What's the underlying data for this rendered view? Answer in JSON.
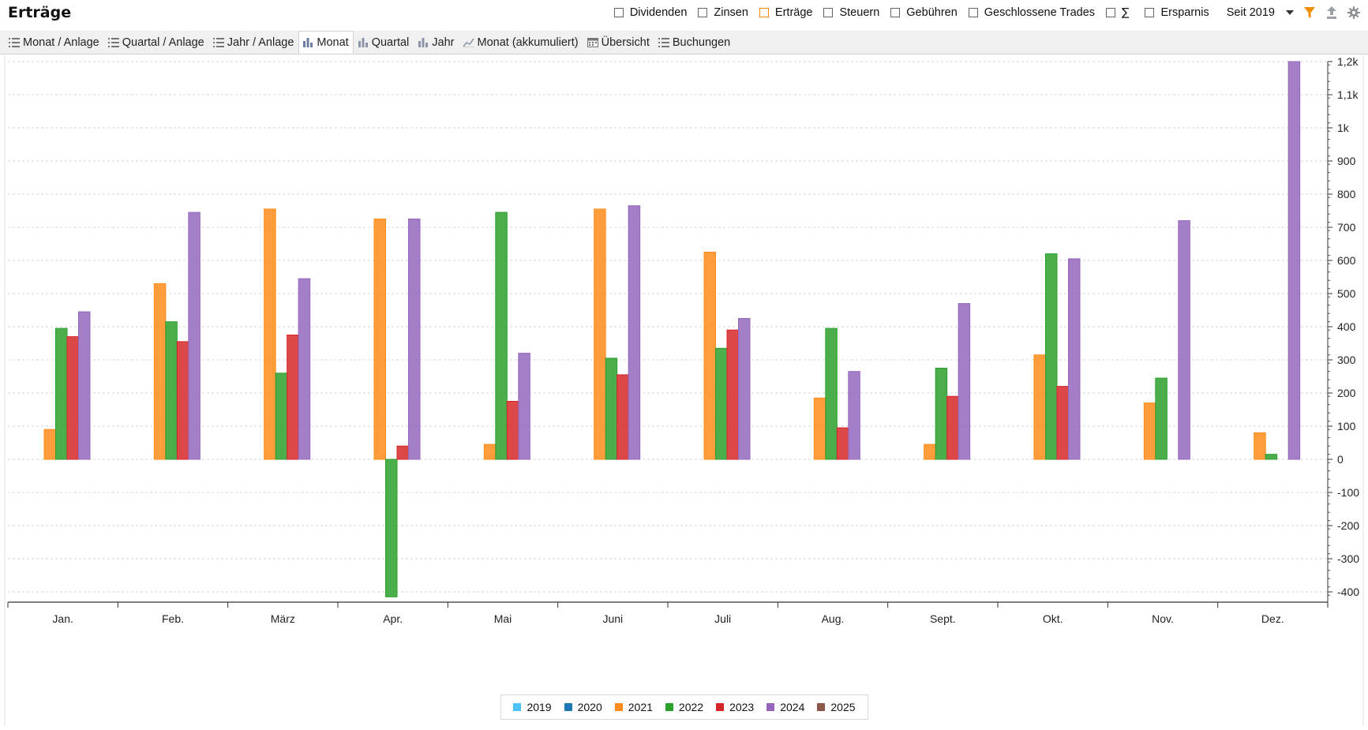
{
  "header": {
    "title": "Erträge",
    "filters": [
      {
        "label": "Dividenden",
        "active": false
      },
      {
        "label": "Zinsen",
        "active": false
      },
      {
        "label": "Erträge",
        "active": true
      },
      {
        "label": "Steuern",
        "active": false
      },
      {
        "label": "Gebühren",
        "active": false
      },
      {
        "label": "Geschlossene Trades",
        "active": false
      },
      {
        "label": "Ersparnis",
        "active": false
      }
    ],
    "sum_symbol": "∑",
    "period": "Seit 2019",
    "icons": [
      "filter-icon",
      "export-icon",
      "gear-icon"
    ],
    "colors": {
      "filter_icon": "#f08c00"
    }
  },
  "tabs": [
    {
      "label": "Monat / Anlage",
      "icon": "list-icon"
    },
    {
      "label": "Quartal / Anlage",
      "icon": "list-icon"
    },
    {
      "label": "Jahr / Anlage",
      "icon": "list-icon"
    },
    {
      "label": "Monat",
      "icon": "bar-chart-icon",
      "active": true
    },
    {
      "label": "Quartal",
      "icon": "bar-chart-icon"
    },
    {
      "label": "Jahr",
      "icon": "bar-chart-icon"
    },
    {
      "label": "Monat (akkumuliert)",
      "icon": "line-chart-icon"
    },
    {
      "label": "Übersicht",
      "icon": "calendar-icon"
    },
    {
      "label": "Buchungen",
      "icon": "list-icon"
    }
  ],
  "chart_data": {
    "type": "bar",
    "categories": [
      "Jan.",
      "Feb.",
      "März",
      "Apr.",
      "Mai",
      "Juni",
      "Juli",
      "Aug.",
      "Sept.",
      "Okt.",
      "Nov.",
      "Dez."
    ],
    "series": [
      {
        "name": "2019",
        "color": "#4fc3f7",
        "values": [
          0,
          0,
          0,
          0,
          0,
          0,
          0,
          0,
          0,
          0,
          0,
          0
        ]
      },
      {
        "name": "2020",
        "color": "#1f77b4",
        "values": [
          0,
          0,
          0,
          0,
          0,
          0,
          0,
          0,
          0,
          0,
          0,
          0
        ]
      },
      {
        "name": "2021",
        "color": "#ff8c1a",
        "values": [
          90,
          530,
          755,
          725,
          45,
          755,
          625,
          185,
          45,
          315,
          170,
          80
        ]
      },
      {
        "name": "2022",
        "color": "#2ca02c",
        "values": [
          395,
          415,
          260,
          -415,
          745,
          305,
          335,
          395,
          275,
          620,
          245,
          15
        ]
      },
      {
        "name": "2023",
        "color": "#d62728",
        "values": [
          370,
          355,
          375,
          40,
          175,
          255,
          390,
          95,
          190,
          220,
          0,
          0
        ]
      },
      {
        "name": "2024",
        "color": "#9467bd",
        "values": [
          445,
          745,
          545,
          725,
          320,
          765,
          425,
          265,
          470,
          605,
          720,
          1200
        ]
      },
      {
        "name": "2025",
        "color": "#8c564b",
        "values": [
          0,
          0,
          0,
          0,
          0,
          0,
          0,
          0,
          0,
          0,
          0,
          0
        ]
      }
    ],
    "ylim": [
      -410,
      1200
    ],
    "yticks": [
      -400,
      -300,
      -200,
      -100,
      0,
      100,
      200,
      300,
      400,
      500,
      600,
      700,
      800,
      900,
      1000,
      1100,
      1200
    ],
    "ytick_labels": [
      "-400",
      "-300",
      "-200",
      "-100",
      "0",
      "100",
      "200",
      "300",
      "400",
      "500",
      "600",
      "700",
      "800",
      "900",
      "1k",
      "1,1k",
      "1,2k"
    ],
    "y_axis_side": "right",
    "grid": true,
    "legend_position": "bottom-center"
  }
}
